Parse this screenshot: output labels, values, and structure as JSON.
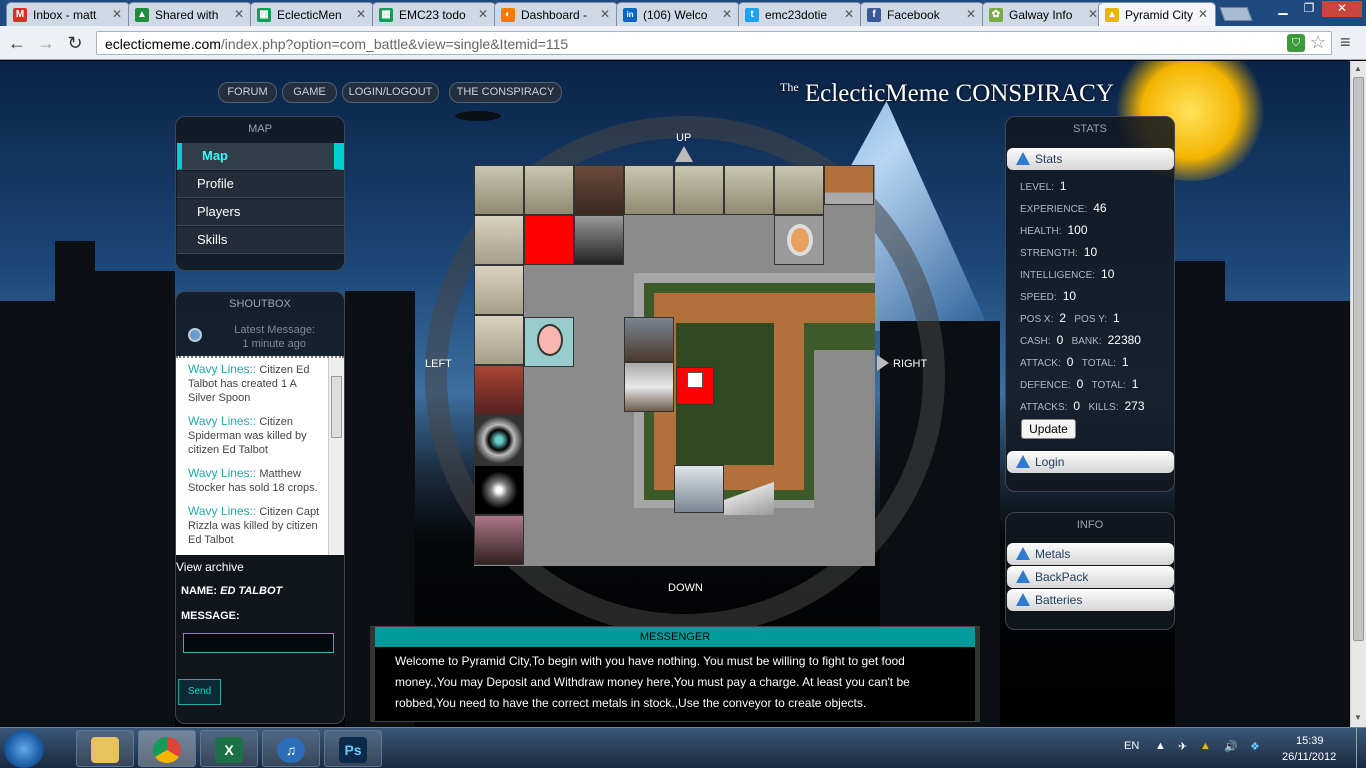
{
  "browser": {
    "tabs": [
      {
        "label": "Inbox - matt",
        "icon_color": "#d93025",
        "glyph": "M"
      },
      {
        "label": "Shared with",
        "icon_color": "#1e8e3e",
        "glyph": "▲"
      },
      {
        "label": "EclecticMen",
        "icon_color": "#0f9d58",
        "glyph": "▦"
      },
      {
        "label": "EMC23 todo",
        "icon_color": "#0f9d58",
        "glyph": "▦"
      },
      {
        "label": "Dashboard -",
        "icon_color": "#f57c00",
        "glyph": "◐"
      },
      {
        "label": "(106) Welco",
        "icon_color": "#0a66c2",
        "glyph": "in"
      },
      {
        "label": "emc23dotie",
        "icon_color": "#1da1f2",
        "glyph": "t"
      },
      {
        "label": "Facebook",
        "icon_color": "#3b5998",
        "glyph": "f"
      },
      {
        "label": "Galway Info",
        "icon_color": "#7a4",
        "glyph": "✿"
      },
      {
        "label": "Pyramid City",
        "icon_color": "#e8b500",
        "glyph": "▲"
      }
    ],
    "url_domain": "eclecticmeme.com",
    "url_path": "/index.php?option=com_battle&view=single&Itemid=115"
  },
  "site": {
    "nav": [
      "FORUM",
      "GAME",
      "LOGIN/LOGOUT",
      "THE CONSPIRACY"
    ],
    "logo_the": "The",
    "logo": "EclecticMeme CONSPIRACY"
  },
  "map_panel": {
    "title": "MAP",
    "items": [
      "Map",
      "Profile",
      "Players",
      "Skills"
    ]
  },
  "shoutbox": {
    "title": "SHOUTBOX",
    "latest_label": "Latest Message:",
    "latest_time": "1 minute ago",
    "messages": [
      {
        "who": "Wavy Lines::",
        "text": "Citizen Ed Talbot has created 1 A Silver Spoon"
      },
      {
        "who": "Wavy Lines::",
        "text": "Citizen Spiderman was killed by citizen Ed Talbot"
      },
      {
        "who": "Wavy Lines::",
        "text": "Matthew Stocker has sold 18 crops."
      },
      {
        "who": "Wavy Lines::",
        "text": "Citizen Capt Rizzla was killed by citizen Ed Talbot"
      }
    ],
    "view_archive": "View archive",
    "name_label": "NAME:",
    "name_value": "ED TALBOT",
    "message_label": "MESSAGE:",
    "message_value": "",
    "send": "Send"
  },
  "board": {
    "up": "UP",
    "down": "DOWN",
    "left": "LEFT",
    "right": "RIGHT"
  },
  "messenger": {
    "title": "MESSENGER",
    "text": "Welcome to Pyramid City,To begin with you have nothing. You must be willing to fight to get food money.,You may Deposit and Withdraw money here,You must pay a charge. At least you can't be robbed,You need to have the correct metals in stock.,Use the conveyor to create objects."
  },
  "stats": {
    "title": "STATS",
    "header": "Stats",
    "level_label": "LEVEL:",
    "level": "1",
    "experience_label": "EXPERIENCE:",
    "experience": "46",
    "health_label": "HEALTH:",
    "health": "100",
    "strength_label": "STRENGTH:",
    "strength": "10",
    "intelligence_label": "INTELLIGENCE:",
    "intelligence": "10",
    "speed_label": "SPEED:",
    "speed": "10",
    "posx_label": "POS X:",
    "posx": "2",
    "posy_label": "POS Y:",
    "posy": "1",
    "cash_label": "CASH:",
    "cash": "0",
    "bank_label": "BANK:",
    "bank": "22380",
    "attack_label": "ATTACK:",
    "attack": "0",
    "attack_total_label": "TOTAL:",
    "attack_total": "1",
    "defence_label": "DEFENCE:",
    "defence": "0",
    "defence_total_label": "TOTAL:",
    "defence_total": "1",
    "attacks_label": "ATTACKS:",
    "attacks": "0",
    "kills_label": "KILLS:",
    "kills": "273",
    "update": "Update",
    "login": "Login"
  },
  "info": {
    "title": "INFO",
    "items": [
      "Metals",
      "BackPack",
      "Batteries"
    ]
  },
  "taskbar": {
    "lang": "EN",
    "time": "15:39",
    "date": "26/11/2012"
  }
}
